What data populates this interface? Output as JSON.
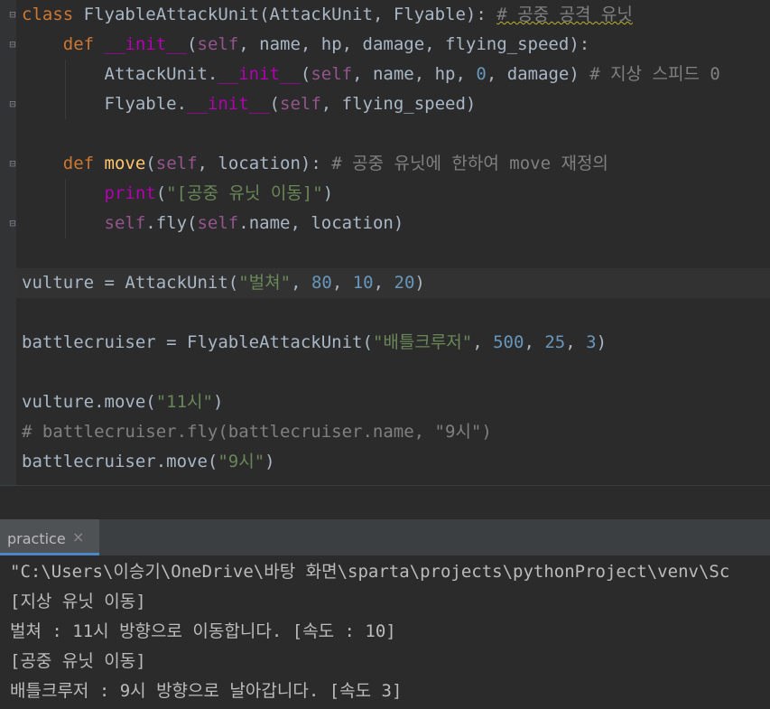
{
  "editor": {
    "lines": [
      [
        {
          "t": "class ",
          "c": "kw"
        },
        {
          "t": "FlyableAttackUnit",
          "c": "plain"
        },
        {
          "t": "(AttackUnit, Flyable): ",
          "c": "plain"
        },
        {
          "t": "# 공중 공격 유닛",
          "c": "cmt wavy"
        }
      ],
      [
        {
          "t": "    "
        },
        {
          "t": "def ",
          "c": "kw"
        },
        {
          "t": "__init__",
          "c": "mag"
        },
        {
          "t": "(",
          "c": "plain"
        },
        {
          "t": "self",
          "c": "slf"
        },
        {
          "t": ", name, hp, damage, flying_speed):",
          "c": "plain"
        }
      ],
      [
        {
          "t": "        AttackUnit.",
          "c": "plain"
        },
        {
          "t": "__init__",
          "c": "mag"
        },
        {
          "t": "(",
          "c": "plain"
        },
        {
          "t": "self",
          "c": "slf"
        },
        {
          "t": ", name, hp, ",
          "c": "plain"
        },
        {
          "t": "0",
          "c": "num"
        },
        {
          "t": ", damage) ",
          "c": "plain"
        },
        {
          "t": "# 지상 스피드 0",
          "c": "cmt"
        }
      ],
      [
        {
          "t": "        Flyable.",
          "c": "plain"
        },
        {
          "t": "__init__",
          "c": "mag"
        },
        {
          "t": "(",
          "c": "plain"
        },
        {
          "t": "self",
          "c": "slf"
        },
        {
          "t": ", flying_speed)",
          "c": "plain"
        }
      ],
      [],
      [
        {
          "t": "    "
        },
        {
          "t": "def ",
          "c": "kw"
        },
        {
          "t": "move",
          "c": "fn"
        },
        {
          "t": "(",
          "c": "plain"
        },
        {
          "t": "self",
          "c": "slf"
        },
        {
          "t": ", location): ",
          "c": "plain"
        },
        {
          "t": "# 공중 유닛에 한하여 move 재정의",
          "c": "cmt"
        }
      ],
      [
        {
          "t": "        "
        },
        {
          "t": "print",
          "c": "mag"
        },
        {
          "t": "(",
          "c": "plain"
        },
        {
          "t": "\"[공중 유닛 이동]\"",
          "c": "str"
        },
        {
          "t": ")",
          "c": "plain"
        }
      ],
      [
        {
          "t": "        "
        },
        {
          "t": "self",
          "c": "slf"
        },
        {
          "t": ".fly(",
          "c": "plain"
        },
        {
          "t": "self",
          "c": "slf"
        },
        {
          "t": ".name, location)",
          "c": "plain"
        }
      ],
      [],
      [
        {
          "t": "vulture = AttackUnit(",
          "c": "plain"
        },
        {
          "t": "\"벌쳐\"",
          "c": "str"
        },
        {
          "t": ", ",
          "c": "plain"
        },
        {
          "t": "80",
          "c": "num"
        },
        {
          "t": ", ",
          "c": "plain"
        },
        {
          "t": "10",
          "c": "num"
        },
        {
          "t": ", ",
          "c": "plain"
        },
        {
          "t": "20",
          "c": "num"
        },
        {
          "t": ")",
          "c": "plain"
        }
      ],
      [],
      [
        {
          "t": "battlecruiser = FlyableAttackUnit(",
          "c": "plain"
        },
        {
          "t": "\"배틀크루저\"",
          "c": "str"
        },
        {
          "t": ", ",
          "c": "plain"
        },
        {
          "t": "500",
          "c": "num"
        },
        {
          "t": ", ",
          "c": "plain"
        },
        {
          "t": "25",
          "c": "num"
        },
        {
          "t": ", ",
          "c": "plain"
        },
        {
          "t": "3",
          "c": "num"
        },
        {
          "t": ")",
          "c": "plain"
        }
      ],
      [],
      [
        {
          "t": "vulture.move(",
          "c": "plain"
        },
        {
          "t": "\"11시\"",
          "c": "str"
        },
        {
          "t": ")",
          "c": "plain"
        }
      ],
      [
        {
          "t": "# battlecruiser.fly(battlecruiser.name, \"9시\")",
          "c": "cmt"
        }
      ],
      [
        {
          "t": "battlecruiser.move(",
          "c": "plain"
        },
        {
          "t": "\"9시\"",
          "c": "str"
        },
        {
          "t": ")",
          "c": "plain"
        }
      ]
    ],
    "colors": {
      "background": "#2b2b2b",
      "keyword": "#cc7832",
      "function": "#ffc66d",
      "self": "#94558d",
      "number": "#6897bb",
      "string": "#6a8759",
      "comment": "#808080"
    }
  },
  "run_panel": {
    "tab_label": "practice",
    "close_icon": "×",
    "output": [
      "\"C:\\Users\\이승기\\OneDrive\\바탕 화면\\sparta\\projects\\pythonProject\\venv\\Sc",
      "[지상 유닛 이동]",
      "벌쳐 : 11시 방향으로 이동합니다. [속도 : 10]",
      "[공중 유닛 이동]",
      "배틀크루저 : 9시 방향으로 날아갑니다. [속도 3]"
    ]
  }
}
